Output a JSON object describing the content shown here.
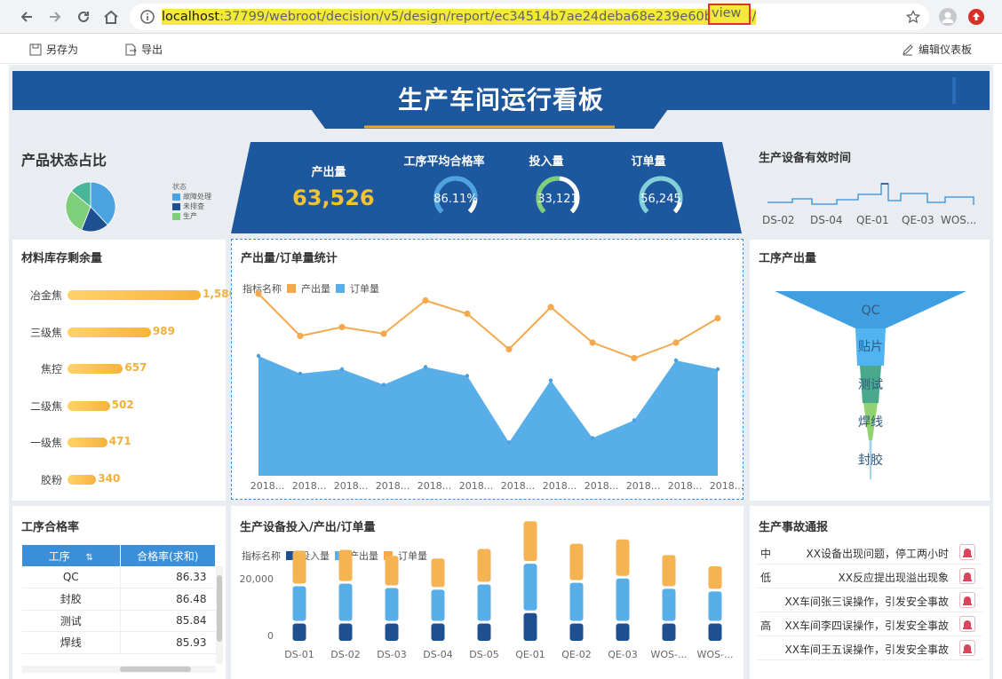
{
  "browser": {
    "url_host": "localhost",
    "url_port": ":37799",
    "url_path": "/webroot/decision/v5/design/report/ec34514b7ae24deba68e239e60bac264/",
    "url_view": "view"
  },
  "toolbar": {
    "save_as": "另存为",
    "export": "导出",
    "edit_dashboard": "编辑仪表板"
  },
  "dashboard": {
    "title": "生产车间运行看板",
    "accent": "#1d579e"
  },
  "product_status": {
    "title": "产品状态占比",
    "legend_title": "状态",
    "legend": [
      {
        "label": "故障处理",
        "color": "#4ba3e0"
      },
      {
        "label": "未排查",
        "color": "#1d4f91"
      },
      {
        "label": "生产",
        "color": "#7fcf7a"
      }
    ],
    "slices": [
      {
        "value": 38,
        "color": "#4ba3e0"
      },
      {
        "value": 18,
        "color": "#1d4f91"
      },
      {
        "value": 30,
        "color": "#7fcf7a"
      },
      {
        "value": 14,
        "color": "#4bb59a"
      }
    ]
  },
  "kpis": {
    "output_label": "产出量",
    "output_value": "63,526",
    "pass_rate_label": "工序平均合格率",
    "pass_rate_value": "86.11%",
    "pass_rate_ratio": 0.86,
    "input_label": "投入量",
    "input_value": "33,121",
    "input_ratio": 0.52,
    "order_label": "订单量",
    "order_value": "56,245",
    "order_ratio": 0.88
  },
  "equipment_time": {
    "title": "生产设备有效时间",
    "ticks": [
      "DS-02",
      "DS-04",
      "QE-01",
      "QE-03",
      "WOS..."
    ]
  },
  "materials": {
    "title": "材料库存剩余量",
    "items": [
      {
        "name": "冶金焦",
        "value": 1580,
        "label": "1,580"
      },
      {
        "name": "三级焦",
        "value": 989,
        "label": "989"
      },
      {
        "name": "焦控",
        "value": 657,
        "label": "657"
      },
      {
        "name": "二级焦",
        "value": 502,
        "label": "502"
      },
      {
        "name": "一级焦",
        "value": 471,
        "label": "471"
      },
      {
        "name": "胶粉",
        "value": 340,
        "label": "340"
      }
    ]
  },
  "output_order_chart": {
    "title": "产出量/订单量统计",
    "legend_title": "指标名称",
    "series_output": "产出量",
    "series_order": "订单量",
    "x_label": "2018...",
    "output": [
      8200,
      6300,
      6700,
      6400,
      7900,
      7300,
      5700,
      7600,
      6000,
      5300,
      6000,
      7100
    ],
    "order": [
      5400,
      4600,
      4800,
      4100,
      4900,
      4500,
      1500,
      4300,
      1700,
      2500,
      5200,
      4800
    ],
    "ymax": 10000
  },
  "process_output": {
    "title": "工序产出量",
    "stages": [
      "QC",
      "贴片",
      "测试",
      "焊线",
      "封胶"
    ]
  },
  "pass_rate": {
    "title": "工序合格率",
    "col_process": "工序",
    "col_rate": "合格率(求和)",
    "rows": [
      {
        "process": "QC",
        "rate": "86.33"
      },
      {
        "process": "封胶",
        "rate": "86.48"
      },
      {
        "process": "测试",
        "rate": "85.84"
      },
      {
        "process": "焊线",
        "rate": "85.93"
      }
    ]
  },
  "equipment_chart": {
    "title": "生产设备投入/产出/订单量",
    "legend_title": "指标名称",
    "series_input": "投入量",
    "series_output": "产出量",
    "series_order": "订单量",
    "y_top": "20,000",
    "y_zero": "0",
    "categories": [
      "DS-01",
      "DS-02",
      "DS-03",
      "DS-04",
      "DS-05",
      "QE-01",
      "QE-02",
      "QE-03",
      "WOS-...",
      "WOS-..."
    ],
    "input": [
      2000,
      2000,
      2000,
      2000,
      2000,
      3200,
      2000,
      2000,
      2000,
      2000
    ],
    "output": [
      4000,
      4300,
      3800,
      3600,
      4200,
      5400,
      4400,
      4900,
      3700,
      3400
    ],
    "order": [
      3800,
      3600,
      3400,
      3300,
      3800,
      4600,
      4200,
      4200,
      3600,
      2600
    ],
    "ymax": 20000
  },
  "accidents": {
    "title": "生产事故通报",
    "rows": [
      {
        "level": "中",
        "text": "XX设备出现问题，停工两小时"
      },
      {
        "level": "低",
        "text": "XX反应提出现溢出现象"
      },
      {
        "level": "",
        "text": "XX车间张三误操作，引发安全事故"
      },
      {
        "level": "高",
        "text": "XX车间李四误操作，引发安全事故"
      },
      {
        "level": "",
        "text": "XX车间王五误操作，引发安全事故"
      }
    ]
  }
}
